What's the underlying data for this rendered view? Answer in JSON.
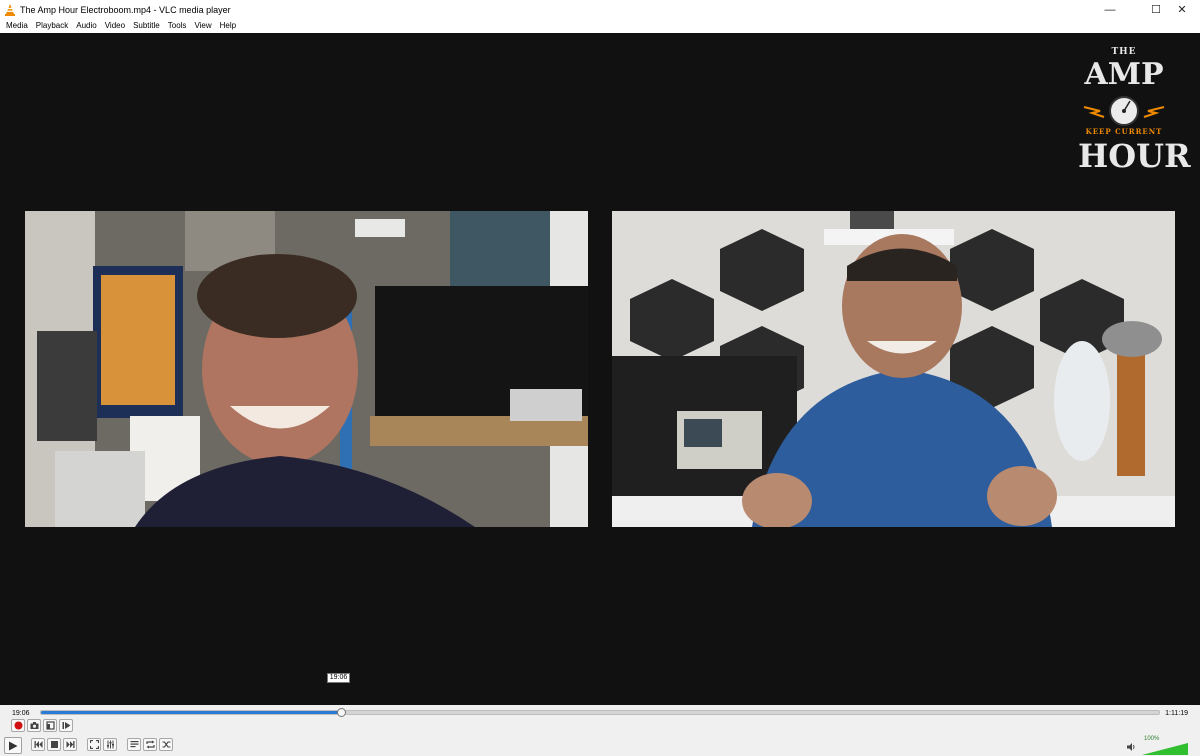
{
  "window": {
    "title": "The Amp Hour Electroboom.mp4 - VLC media player",
    "minimize": "—",
    "maximize": "☐",
    "close": "✕"
  },
  "menu": [
    "Media",
    "Playback",
    "Audio",
    "Video",
    "Subtitle",
    "Tools",
    "View",
    "Help"
  ],
  "logo": {
    "the": "THE",
    "amp": "AMP",
    "tagline": "KEEP CURRENT",
    "hour": "HOUR"
  },
  "playback": {
    "current_time": "19:06",
    "total_time": "1:11:19",
    "tooltip_time": "19:06",
    "progress_fraction": 0.268
  },
  "volume": {
    "label": "100%",
    "level_fraction": 1.0
  },
  "colors": {
    "accent": "#2a7bd6",
    "record": "#d01010",
    "volume": "#2fbf2f",
    "vlc_orange": "#f08a00"
  },
  "icons": {
    "row1": [
      "record-icon",
      "snapshot-icon",
      "loop-ab-icon",
      "frame-step-icon"
    ],
    "row2": [
      "play-icon",
      "previous-icon",
      "stop-icon",
      "next-icon",
      "fullscreen-icon",
      "extended-settings-icon",
      "playlist-icon",
      "loop-icon",
      "shuffle-icon"
    ]
  }
}
